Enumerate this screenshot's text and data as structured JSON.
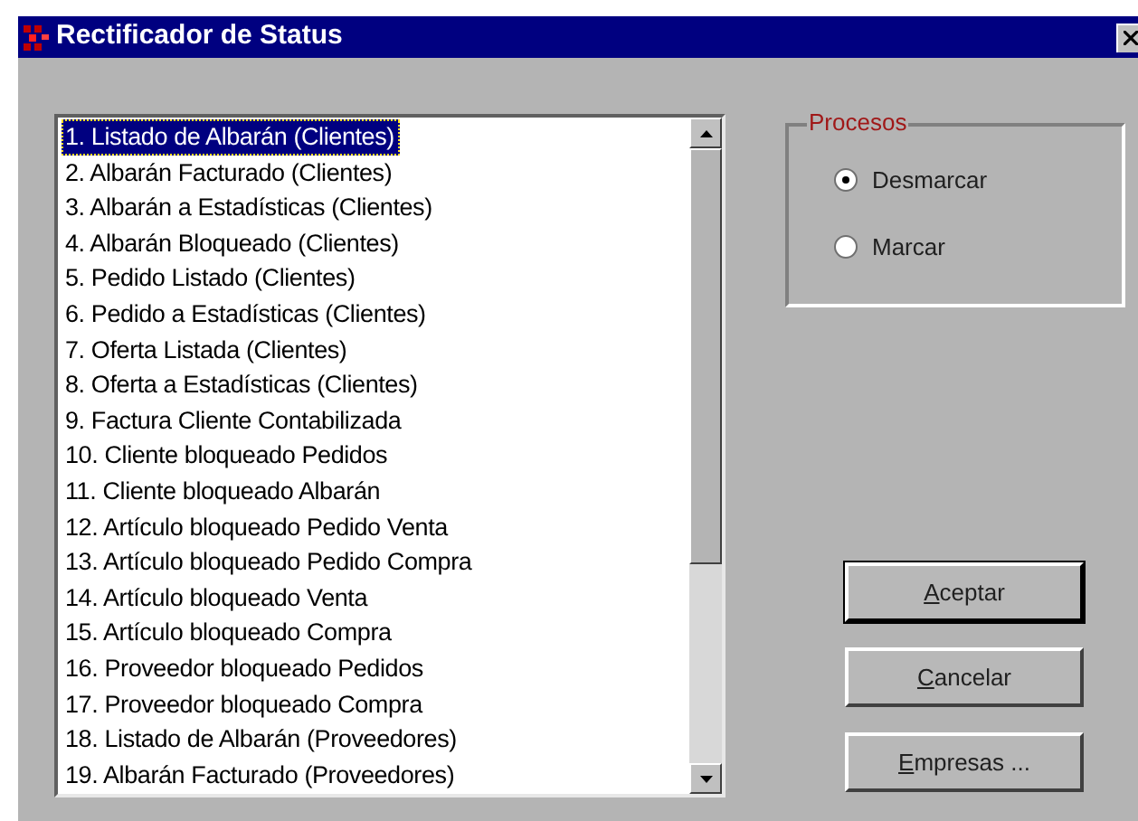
{
  "window": {
    "title": "Rectificador de Status"
  },
  "list": {
    "items": [
      {
        "label": "1. Listado de Albarán (Clientes)",
        "selected": true
      },
      {
        "label": "2. Albarán Facturado (Clientes)",
        "selected": false
      },
      {
        "label": "3. Albarán a Estadísticas (Clientes)",
        "selected": false
      },
      {
        "label": "4. Albarán Bloqueado (Clientes)",
        "selected": false
      },
      {
        "label": "5. Pedido Listado (Clientes)",
        "selected": false
      },
      {
        "label": "6. Pedido a Estadísticas (Clientes)",
        "selected": false
      },
      {
        "label": "7. Oferta Listada (Clientes)",
        "selected": false
      },
      {
        "label": "8. Oferta a Estadísticas (Clientes)",
        "selected": false
      },
      {
        "label": "9. Factura Cliente Contabilizada",
        "selected": false
      },
      {
        "label": "10. Cliente bloqueado Pedidos",
        "selected": false
      },
      {
        "label": "11. Cliente bloqueado Albarán",
        "selected": false
      },
      {
        "label": "12. Artículo bloqueado Pedido Venta",
        "selected": false
      },
      {
        "label": "13. Artículo bloqueado Pedido Compra",
        "selected": false
      },
      {
        "label": "14. Artículo bloqueado Venta",
        "selected": false
      },
      {
        "label": "15. Artículo bloqueado Compra",
        "selected": false
      },
      {
        "label": "16. Proveedor bloqueado Pedidos",
        "selected": false
      },
      {
        "label": "17. Proveedor bloqueado Compra",
        "selected": false
      },
      {
        "label": "18. Listado de Albarán (Proveedores)",
        "selected": false
      },
      {
        "label": "19. Albarán Facturado (Proveedores)",
        "selected": false
      }
    ]
  },
  "group": {
    "title": "Procesos",
    "options": [
      {
        "label": "Desmarcar",
        "selected": true
      },
      {
        "label": "Marcar",
        "selected": false
      }
    ]
  },
  "buttons": [
    {
      "label": "Aceptar",
      "default": true
    },
    {
      "label": "Cancelar",
      "default": false
    },
    {
      "label": "Empresas ...",
      "default": false
    }
  ]
}
